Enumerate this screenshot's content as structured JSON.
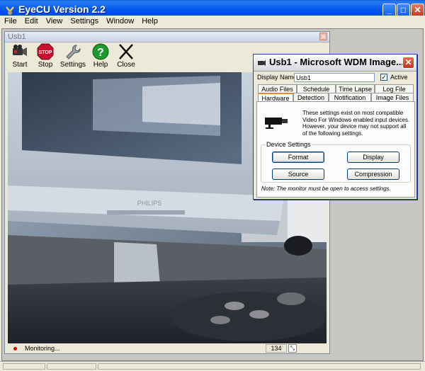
{
  "window": {
    "title": "EyeCU Version 2.2",
    "minimize_glyph": "_",
    "maximize_glyph": "□",
    "close_glyph": "✕"
  },
  "menu": [
    "File",
    "Edit",
    "View",
    "Settings",
    "Window",
    "Help"
  ],
  "child_window": {
    "title": "Usb1",
    "close_glyph": "✕"
  },
  "toolbar": [
    {
      "label": "Start",
      "icon": "camera-icon"
    },
    {
      "label": "Stop",
      "icon": "stop-sign-icon",
      "icon_text": "STOP"
    },
    {
      "label": "Settings",
      "icon": "wrench-icon"
    },
    {
      "label": "Help",
      "icon": "help-icon",
      "icon_text": "?"
    },
    {
      "label": "Close",
      "icon": "close-x-icon"
    }
  ],
  "video": {
    "brand_text": "PHILIPS"
  },
  "child_status": {
    "text": "Monitoring...",
    "count": "134"
  },
  "dialog": {
    "title": "Usb1 - Microsoft WDM Image...",
    "display_name_label": "Display Name:",
    "display_name_value": "Usb1",
    "active_label": "Active",
    "active_checked": true,
    "tabs_row1": [
      "Audio Files",
      "Schedule",
      "Time Lapse",
      "Log File"
    ],
    "tabs_row2": [
      "Hardware",
      "Detection",
      "Notification",
      "Image Files"
    ],
    "selected_tab": "Hardware",
    "info_text": "These settings exist on most compatible Video For Windows enabled input devices. However, your device may not support all of the following settings.",
    "group_label": "Device Settings",
    "buttons": [
      "Format",
      "Display",
      "Source",
      "Compression"
    ],
    "note": "Note: The monitor must be open to access settings."
  },
  "colors": {
    "titlebar": "#0058ee",
    "dialog_tab_accent": "#e68b2c",
    "status_dot": "#dd0000"
  }
}
